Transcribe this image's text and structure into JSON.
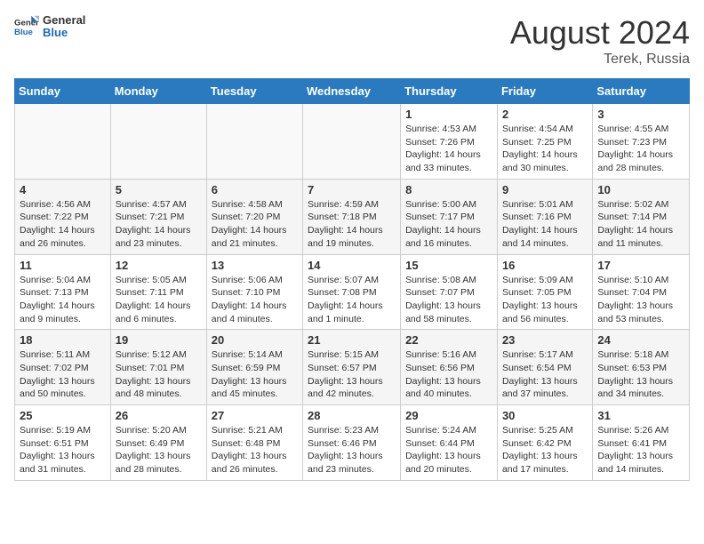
{
  "header": {
    "logo_general": "General",
    "logo_blue": "Blue",
    "month_year": "August 2024",
    "location": "Terek, Russia"
  },
  "weekdays": [
    "Sunday",
    "Monday",
    "Tuesday",
    "Wednesday",
    "Thursday",
    "Friday",
    "Saturday"
  ],
  "weeks": [
    [
      {
        "day": "",
        "info": ""
      },
      {
        "day": "",
        "info": ""
      },
      {
        "day": "",
        "info": ""
      },
      {
        "day": "",
        "info": ""
      },
      {
        "day": "1",
        "info": "Sunrise: 4:53 AM\nSunset: 7:26 PM\nDaylight: 14 hours\nand 33 minutes."
      },
      {
        "day": "2",
        "info": "Sunrise: 4:54 AM\nSunset: 7:25 PM\nDaylight: 14 hours\nand 30 minutes."
      },
      {
        "day": "3",
        "info": "Sunrise: 4:55 AM\nSunset: 7:23 PM\nDaylight: 14 hours\nand 28 minutes."
      }
    ],
    [
      {
        "day": "4",
        "info": "Sunrise: 4:56 AM\nSunset: 7:22 PM\nDaylight: 14 hours\nand 26 minutes."
      },
      {
        "day": "5",
        "info": "Sunrise: 4:57 AM\nSunset: 7:21 PM\nDaylight: 14 hours\nand 23 minutes."
      },
      {
        "day": "6",
        "info": "Sunrise: 4:58 AM\nSunset: 7:20 PM\nDaylight: 14 hours\nand 21 minutes."
      },
      {
        "day": "7",
        "info": "Sunrise: 4:59 AM\nSunset: 7:18 PM\nDaylight: 14 hours\nand 19 minutes."
      },
      {
        "day": "8",
        "info": "Sunrise: 5:00 AM\nSunset: 7:17 PM\nDaylight: 14 hours\nand 16 minutes."
      },
      {
        "day": "9",
        "info": "Sunrise: 5:01 AM\nSunset: 7:16 PM\nDaylight: 14 hours\nand 14 minutes."
      },
      {
        "day": "10",
        "info": "Sunrise: 5:02 AM\nSunset: 7:14 PM\nDaylight: 14 hours\nand 11 minutes."
      }
    ],
    [
      {
        "day": "11",
        "info": "Sunrise: 5:04 AM\nSunset: 7:13 PM\nDaylight: 14 hours\nand 9 minutes."
      },
      {
        "day": "12",
        "info": "Sunrise: 5:05 AM\nSunset: 7:11 PM\nDaylight: 14 hours\nand 6 minutes."
      },
      {
        "day": "13",
        "info": "Sunrise: 5:06 AM\nSunset: 7:10 PM\nDaylight: 14 hours\nand 4 minutes."
      },
      {
        "day": "14",
        "info": "Sunrise: 5:07 AM\nSunset: 7:08 PM\nDaylight: 14 hours\nand 1 minute."
      },
      {
        "day": "15",
        "info": "Sunrise: 5:08 AM\nSunset: 7:07 PM\nDaylight: 13 hours\nand 58 minutes."
      },
      {
        "day": "16",
        "info": "Sunrise: 5:09 AM\nSunset: 7:05 PM\nDaylight: 13 hours\nand 56 minutes."
      },
      {
        "day": "17",
        "info": "Sunrise: 5:10 AM\nSunset: 7:04 PM\nDaylight: 13 hours\nand 53 minutes."
      }
    ],
    [
      {
        "day": "18",
        "info": "Sunrise: 5:11 AM\nSunset: 7:02 PM\nDaylight: 13 hours\nand 50 minutes."
      },
      {
        "day": "19",
        "info": "Sunrise: 5:12 AM\nSunset: 7:01 PM\nDaylight: 13 hours\nand 48 minutes."
      },
      {
        "day": "20",
        "info": "Sunrise: 5:14 AM\nSunset: 6:59 PM\nDaylight: 13 hours\nand 45 minutes."
      },
      {
        "day": "21",
        "info": "Sunrise: 5:15 AM\nSunset: 6:57 PM\nDaylight: 13 hours\nand 42 minutes."
      },
      {
        "day": "22",
        "info": "Sunrise: 5:16 AM\nSunset: 6:56 PM\nDaylight: 13 hours\nand 40 minutes."
      },
      {
        "day": "23",
        "info": "Sunrise: 5:17 AM\nSunset: 6:54 PM\nDaylight: 13 hours\nand 37 minutes."
      },
      {
        "day": "24",
        "info": "Sunrise: 5:18 AM\nSunset: 6:53 PM\nDaylight: 13 hours\nand 34 minutes."
      }
    ],
    [
      {
        "day": "25",
        "info": "Sunrise: 5:19 AM\nSunset: 6:51 PM\nDaylight: 13 hours\nand 31 minutes."
      },
      {
        "day": "26",
        "info": "Sunrise: 5:20 AM\nSunset: 6:49 PM\nDaylight: 13 hours\nand 28 minutes."
      },
      {
        "day": "27",
        "info": "Sunrise: 5:21 AM\nSunset: 6:48 PM\nDaylight: 13 hours\nand 26 minutes."
      },
      {
        "day": "28",
        "info": "Sunrise: 5:23 AM\nSunset: 6:46 PM\nDaylight: 13 hours\nand 23 minutes."
      },
      {
        "day": "29",
        "info": "Sunrise: 5:24 AM\nSunset: 6:44 PM\nDaylight: 13 hours\nand 20 minutes."
      },
      {
        "day": "30",
        "info": "Sunrise: 5:25 AM\nSunset: 6:42 PM\nDaylight: 13 hours\nand 17 minutes."
      },
      {
        "day": "31",
        "info": "Sunrise: 5:26 AM\nSunset: 6:41 PM\nDaylight: 13 hours\nand 14 minutes."
      }
    ]
  ]
}
